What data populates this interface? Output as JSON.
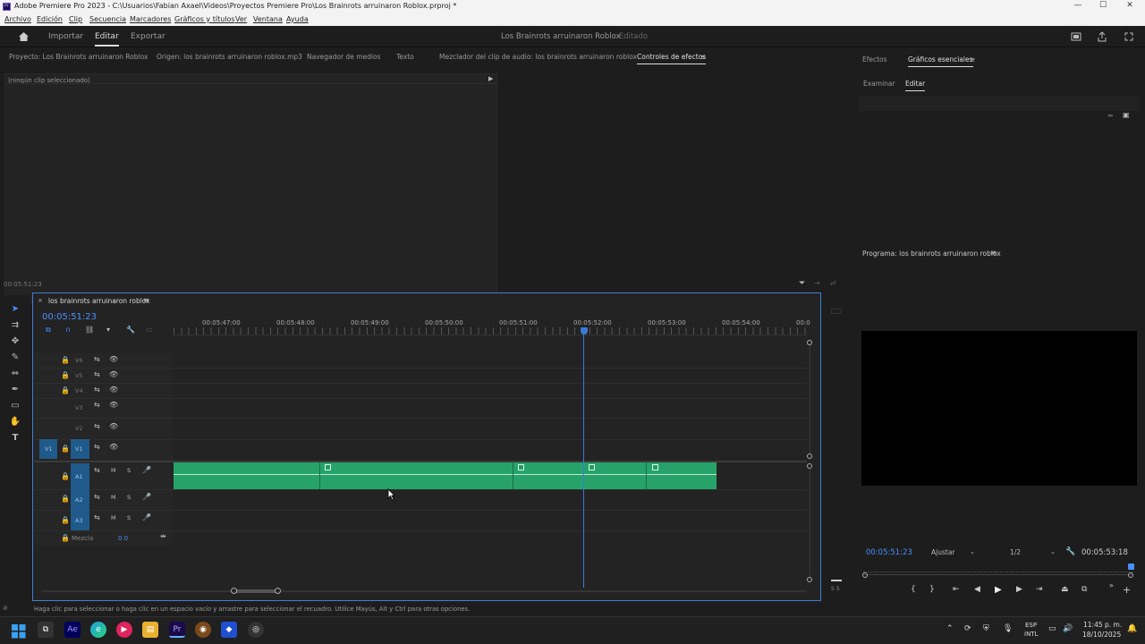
{
  "titlebar": {
    "title": "Adobe Premiere Pro 2023 - C:\\Usuarios\\Fabian Axael\\Videos\\Proyectos Premiere Pro\\Los Brainrots arruinaron Roblox.prproj *",
    "logo": "Pr",
    "minimize": "—",
    "maximize": "☐",
    "close": "✕"
  },
  "menu": [
    "Archivo",
    "Edición",
    "Clip",
    "Secuencia",
    "Marcadores",
    "Gráficos y títulos",
    "Ver",
    "Ventana",
    "Ayuda"
  ],
  "workspace": {
    "home_icon": "home-icon",
    "tabs": [
      "Importar",
      "Editar",
      "Exportar"
    ],
    "active_tab": "Editar",
    "project_title": "Los Brainrots arruinaron Roblox",
    "status": "- Editado"
  },
  "source_panel": {
    "tabs": [
      "Proyecto: Los Brainrots arruinaron Roblox",
      "Origen: los brainrots arruinaron roblox.mp3",
      "Navegador de medios",
      "Texto",
      "Mezclador del clip de audio: los brainrots arruinaron roblox",
      "Controles de efectos"
    ],
    "active_tab": "Controles de efectos",
    "no_clip": "(ningún clip seleccionado)",
    "timecode": "00:05:51:23"
  },
  "essential_graphics": {
    "tabs": [
      "Efectos",
      "Gráficos esenciales"
    ],
    "active_tab": "Gráficos esenciales",
    "subtabs": [
      "Examinar",
      "Editar"
    ],
    "active_subtab": "Editar"
  },
  "program": {
    "title": "Programa: los brainrots arruinaron roblox",
    "timecode": "00:05:51:23",
    "fit": "Ajustar",
    "resolution": "1/2",
    "duration": "00:05:53:18"
  },
  "timeline": {
    "sequence_name": "los brainrots arruinaron roblox",
    "timecode": "00:05:51:23",
    "ruler": [
      "00:05:47:00",
      "00:05:48:00",
      "00:05:49:00",
      "00:05:50:00",
      "00:05:51:00",
      "00:05:52:00",
      "00:05:53:00",
      "00:05:54:00",
      "00:0"
    ],
    "video_tracks": [
      "V6",
      "V5",
      "V4",
      "V3",
      "V2",
      "V1"
    ],
    "source_v": "V1",
    "audio_tracks": [
      "A1",
      "A2",
      "A3"
    ],
    "mix_label": "Mezcla",
    "mix_value": "0.0",
    "clip_color": "#27a36a",
    "playhead_color": "#3a7ad9",
    "audio_meter_labels": "S S"
  },
  "statusbar": {
    "hint": "Haga clic para seleccionar o haga clic en un espacio vacío y arrastre para seleccionar el recuadro. Utilice Mayús, Alt y Ctrl para otras opciones."
  },
  "taskbar": {
    "lang1": "ESP",
    "lang2": "INTL",
    "time": "11:45 p. m.",
    "date": "18/10/2025"
  }
}
